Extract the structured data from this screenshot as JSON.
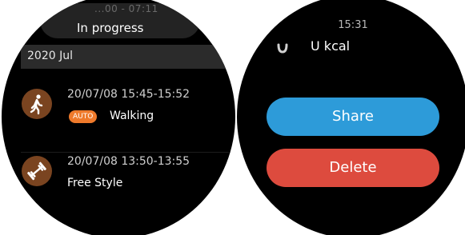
{
  "left_screen": {
    "progress": {
      "time_range": "...00 - 07:11",
      "label": "In progress"
    },
    "month_header": "2020 Jul",
    "activities": [
      {
        "icon": "walking-icon",
        "datetime": "20/07/08  15:45-15:52",
        "badge": "AUTO",
        "name": "Walking"
      },
      {
        "icon": "dumbbell-icon",
        "datetime": "20/07/08  13:50-13:55",
        "name": "Free Style"
      }
    ]
  },
  "right_screen": {
    "time": "15:31",
    "calories": {
      "icon": "flame-icon",
      "value": "U kcal"
    },
    "share_label": "Share",
    "delete_label": "Delete"
  },
  "colors": {
    "icon_bg": "#7a4420",
    "badge": "#ef7a2b",
    "share": "#2d9bd9",
    "delete": "#dd4b3e"
  }
}
